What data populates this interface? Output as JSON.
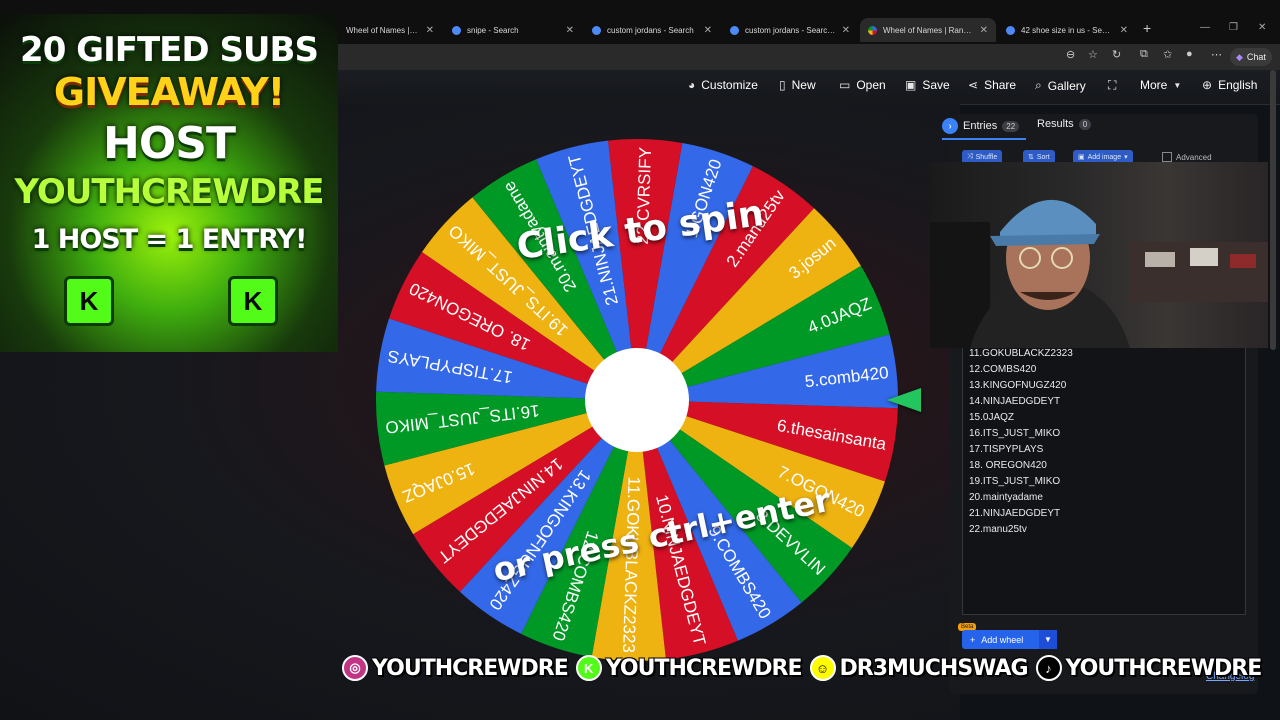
{
  "browser": {
    "tabs": [
      {
        "label": "Wheel of Names | Random n"
      },
      {
        "label": "snipe - Search"
      },
      {
        "label": "custom jordans - Search"
      },
      {
        "label": "custom jordans - Search Ima"
      },
      {
        "label": "Wheel of Names | Random n"
      },
      {
        "label": "42 shoe size in us - Search"
      }
    ],
    "chat_label": "Chat"
  },
  "toolbar": {
    "customize": "Customize",
    "new": "New",
    "open": "Open",
    "save": "Save",
    "share": "Share",
    "gallery": "Gallery",
    "more": "More",
    "language": "English"
  },
  "wheel": {
    "spin_text": "Click to spin",
    "press_text": "or press ctrl+enter",
    "colors": [
      "#3369e8",
      "#d50f25",
      "#eeb211",
      "#009925"
    ],
    "slices": [
      "1.GON420",
      "2.manu25tv",
      "3.josun",
      "4.0JAQZ",
      "5.comb420",
      "6.thesainsanta",
      "7.OGON420",
      "8.DEVVLIN",
      "9.COMBS420",
      "10.NINJAEDGDEYT",
      "11.GOKUBLACKZ2323",
      "12.COMBS420",
      "13.KINGOFNUGZ420",
      "14.NINJAEDGDEYT",
      "15.0JAQZ",
      "16.ITS_JUST_MIKO",
      "17.TISPYPLAYS",
      "18. OREGON420",
      "19.ITS_JUST_MIKO",
      "20.maintyadame",
      "21.NINJAEDGDEYT",
      "22.CVRSIFY"
    ]
  },
  "panel": {
    "tab_entries": "Entries",
    "entries_count": "22",
    "tab_results": "Results",
    "results_count": "0",
    "shuffle": "Shuffle",
    "sort": "Sort",
    "add_image": "Add image",
    "advanced": "Advanced",
    "visible_entries": [
      "11.GOKUBLACKZ2323",
      "12.COMBS420",
      "13.KINGOFNUGZ420",
      "14.NINJAEDGDEYT",
      "15.0JAQZ",
      "16.ITS_JUST_MIKO",
      "17.TISPYPLAYS",
      "18. OREGON420",
      "19.ITS_JUST_MIKO",
      "20.maintyadame",
      "21.NINJAEDGDEYT",
      "22.manu25tv"
    ],
    "beta": "Beta",
    "add_wheel": "Add wheel",
    "changelog": "Changelog"
  },
  "promo": {
    "line1": "20 GIFTED SUBS",
    "line2": "GIVEAWAY!",
    "line3": "HOST",
    "line4": "YOUTHCREWDRE",
    "line5": "1 HOST = 1 ENTRY!",
    "badge": "K"
  },
  "social": [
    {
      "icon": "instagram-icon",
      "handle": "YOUTHCREWDRE",
      "color": "#c13584"
    },
    {
      "icon": "kick-icon",
      "handle": "YOUTHCREWDRE",
      "color": "#53fc18"
    },
    {
      "icon": "snapchat-icon",
      "handle": "DR3MUCHSWAG",
      "color": "#fffc00"
    },
    {
      "icon": "tiktok-icon",
      "handle": "YOUTHCREWDRE",
      "color": "#000000"
    }
  ]
}
